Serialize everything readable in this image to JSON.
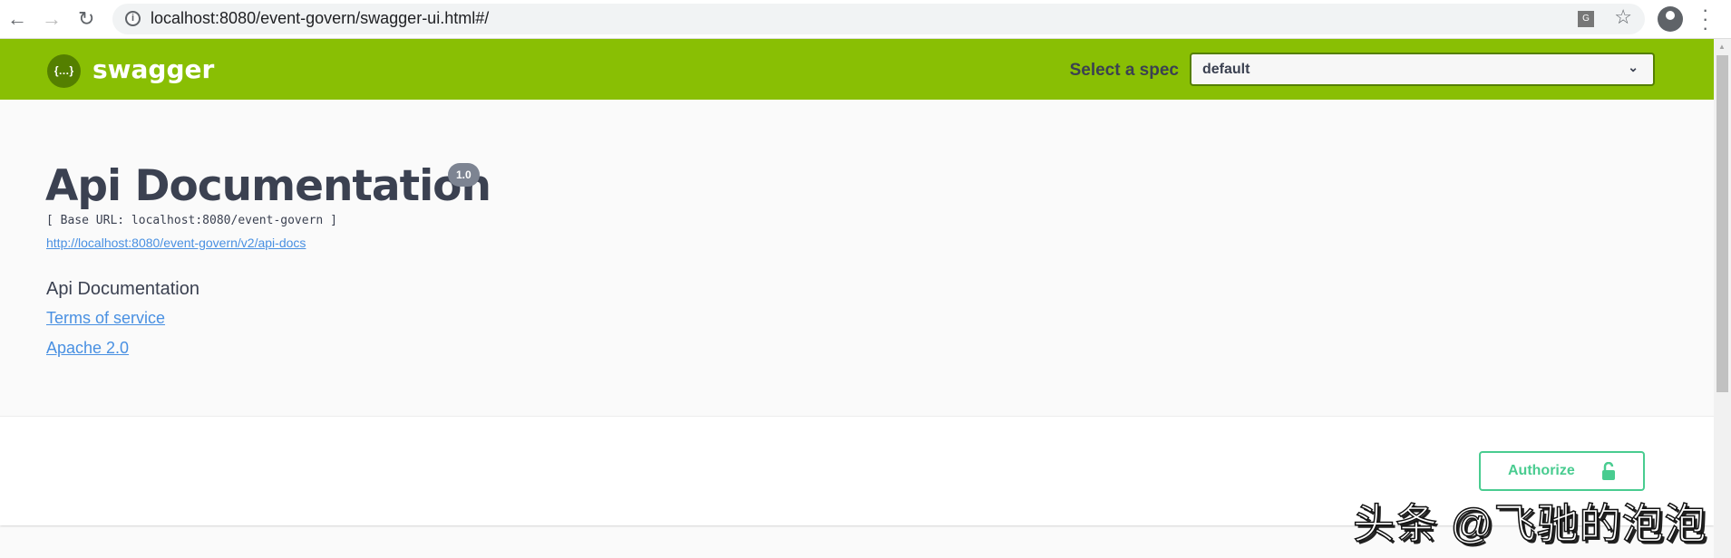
{
  "browser": {
    "url": "localhost:8080/event-govern/swagger-ui.html#/",
    "icons": [
      "back-icon",
      "forward-icon",
      "reload-icon",
      "info-icon",
      "translate-icon",
      "star-icon",
      "profile-icon",
      "menu-icon"
    ]
  },
  "header": {
    "brand": "swagger",
    "logo_glyph": "{…}",
    "spec_label": "Select a spec",
    "spec_value": "default",
    "color": "#89bf04"
  },
  "info": {
    "title": "Api Documentation",
    "version": "1.0",
    "base_url": "[ Base URL: localhost:8080/event-govern ]",
    "docs_link": "http://localhost:8080/event-govern/v2/api-docs",
    "description": "Api Documentation",
    "terms": "Terms of service",
    "license": "Apache 2.0"
  },
  "scheme": {
    "authorize_label": "Authorize",
    "accent": "#49cc90"
  },
  "watermark": "头条 @飞驰的泡泡"
}
